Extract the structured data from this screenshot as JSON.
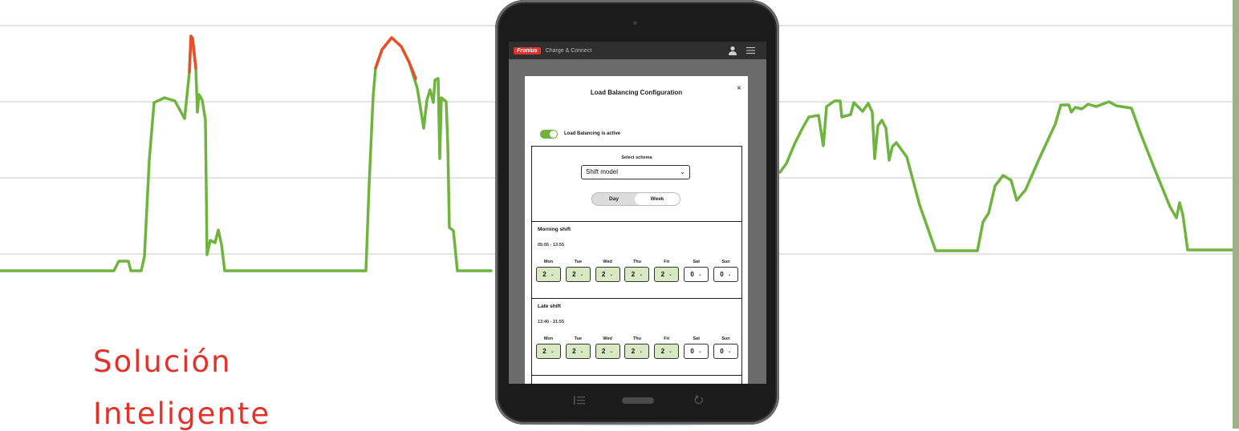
{
  "headline": {
    "line1": "Solución",
    "line2": "Inteligente"
  },
  "colors": {
    "accent": "#e2322a",
    "chart_line": "#6fb43f",
    "chart_peak": "#e94e2a",
    "active_day": "#d8e8c3"
  },
  "app": {
    "logo": "Fronius",
    "title": "Charge & Connect",
    "icons": [
      "user-icon",
      "menu-icon"
    ]
  },
  "modal": {
    "title": "Load Balancing Configuration",
    "close": "×",
    "toggle_label": "Load Balancing is active",
    "toggle_on": true,
    "schema_label": "Select schema",
    "schema_value": "Shift model",
    "segment": {
      "day": "Day",
      "week": "Week",
      "selected": "Week"
    },
    "shifts": [
      {
        "name": "Morning shift",
        "time": "05:55 - 13:55",
        "days": [
          {
            "label": "Mon",
            "value": "2",
            "active": true
          },
          {
            "label": "Tue",
            "value": "2",
            "active": true
          },
          {
            "label": "Wed",
            "value": "2",
            "active": true
          },
          {
            "label": "Thu",
            "value": "2",
            "active": true
          },
          {
            "label": "Fri",
            "value": "2",
            "active": true
          },
          {
            "label": "Sat",
            "value": "0",
            "active": false
          },
          {
            "label": "Sun",
            "value": "0",
            "active": false
          }
        ]
      },
      {
        "name": "Late shift",
        "time": "13:40 - 21:55",
        "days": [
          {
            "label": "Mon",
            "value": "2",
            "active": true
          },
          {
            "label": "Tue",
            "value": "2",
            "active": true
          },
          {
            "label": "Wed",
            "value": "2",
            "active": true
          },
          {
            "label": "Thu",
            "value": "2",
            "active": true
          },
          {
            "label": "Fri",
            "value": "2",
            "active": true
          },
          {
            "label": "Sat",
            "value": "0",
            "active": false
          },
          {
            "label": "Sun",
            "value": "0",
            "active": false
          }
        ]
      }
    ]
  }
}
